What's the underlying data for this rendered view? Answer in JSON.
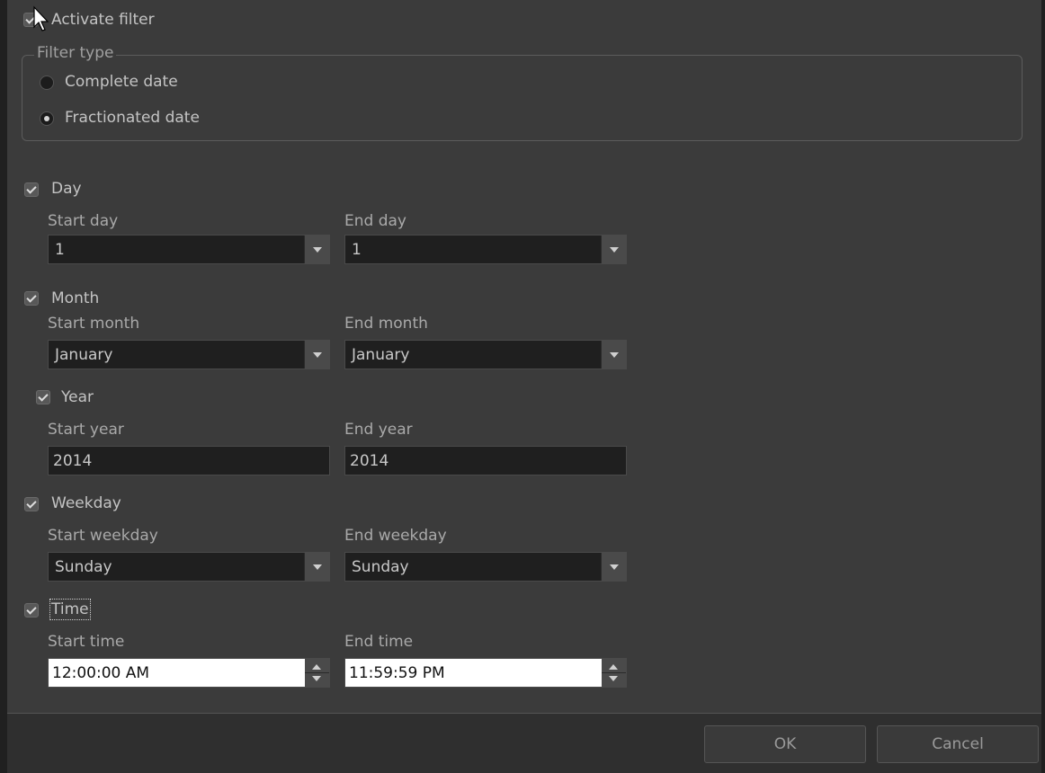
{
  "filter": {
    "activate_label": "Activate filter",
    "activate_checked": true
  },
  "filter_type": {
    "title": "Filter type",
    "options": [
      {
        "label": "Complete date",
        "selected": false
      },
      {
        "label": "Fractionated date",
        "selected": true
      }
    ]
  },
  "day": {
    "label": "Day",
    "checked": true,
    "start_label": "Start day",
    "end_label": "End day",
    "start_value": "1",
    "end_value": "1"
  },
  "month": {
    "label": "Month",
    "checked": true,
    "start_label": "Start month",
    "end_label": "End month",
    "start_value": "January",
    "end_value": "January"
  },
  "year": {
    "label": "Year",
    "checked": true,
    "start_label": "Start year",
    "end_label": "End year",
    "start_value": "2014",
    "end_value": "2014"
  },
  "weekday": {
    "label": "Weekday",
    "checked": true,
    "start_label": "Start weekday",
    "end_label": "End weekday",
    "start_value": "Sunday",
    "end_value": "Sunday"
  },
  "time": {
    "label": "Time",
    "checked": true,
    "start_label": "Start time",
    "end_label": "End time",
    "start_value": "12:00:00 AM",
    "end_value": "11:59:59 PM"
  },
  "footer": {
    "ok_label": "OK",
    "cancel_label": "Cancel"
  },
  "colors": {
    "background": "#3b3b3b",
    "field_background": "#1f1f1f",
    "text": "#c4c4c4"
  }
}
